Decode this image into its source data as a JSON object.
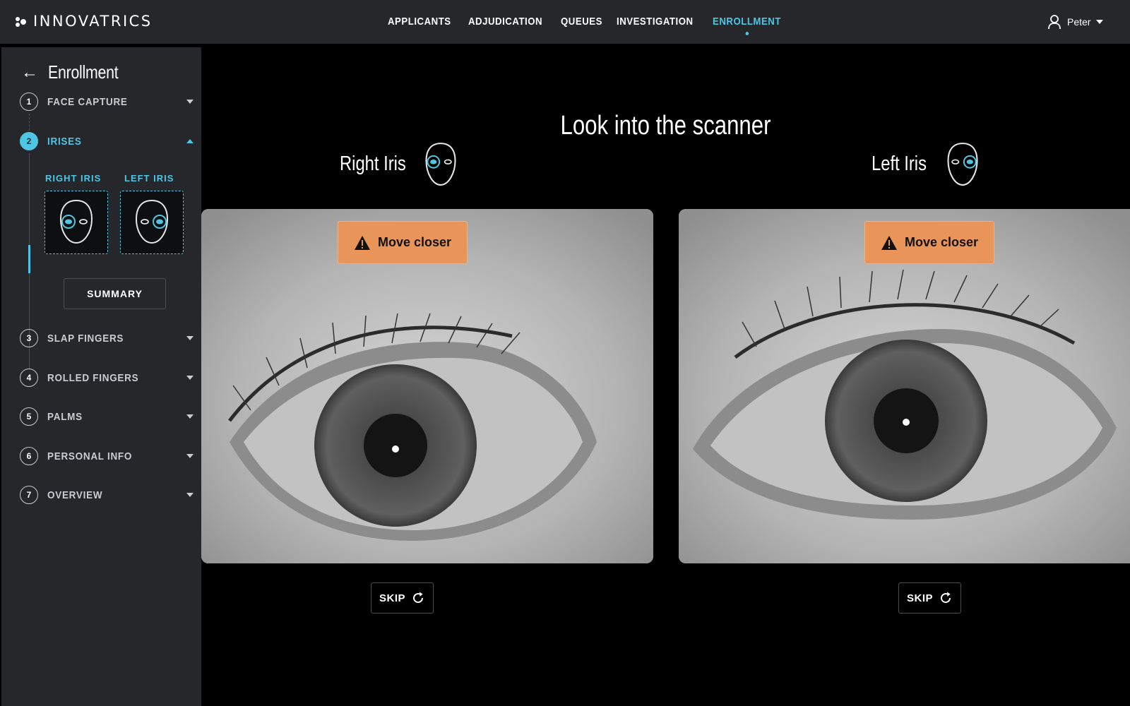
{
  "brand": {
    "name": "INNOVATRICS"
  },
  "nav": {
    "items": [
      {
        "label": "APPLICANTS",
        "active": false
      },
      {
        "label": "ADJUDICATION",
        "active": false
      },
      {
        "label": "QUEUES",
        "active": false
      },
      {
        "label": "INVESTIGATION",
        "active": false
      },
      {
        "label": "ENROLLMENT",
        "active": true
      }
    ]
  },
  "user": {
    "name": "Peter",
    "icon": "user-icon"
  },
  "sidebar": {
    "title": "Enrollment",
    "steps": [
      {
        "num": "1",
        "label": "FACE CAPTURE",
        "expanded": false
      },
      {
        "num": "2",
        "label": "IRISES",
        "expanded": true
      },
      {
        "num": "3",
        "label": "SLAP FINGERS",
        "expanded": false
      },
      {
        "num": "4",
        "label": "ROLLED FINGERS",
        "expanded": false
      },
      {
        "num": "5",
        "label": "PALMS",
        "expanded": false
      },
      {
        "num": "6",
        "label": "PERSONAL INFO",
        "expanded": false
      },
      {
        "num": "7",
        "label": "OVERVIEW",
        "expanded": false
      }
    ],
    "sub": {
      "right_label": "RIGHT IRIS",
      "left_label": "LEFT IRIS"
    },
    "summary_label": "SUMMARY"
  },
  "main": {
    "heading": "Look into the scanner",
    "right": {
      "title": "Right Iris",
      "warning": "Move closer",
      "skip": "SKIP"
    },
    "left": {
      "title": "Left Iris",
      "warning": "Move closer",
      "skip": "SKIP"
    }
  },
  "colors": {
    "accent": "#4ec6e3",
    "warning": "#e9955a",
    "panel": "#25272b"
  }
}
